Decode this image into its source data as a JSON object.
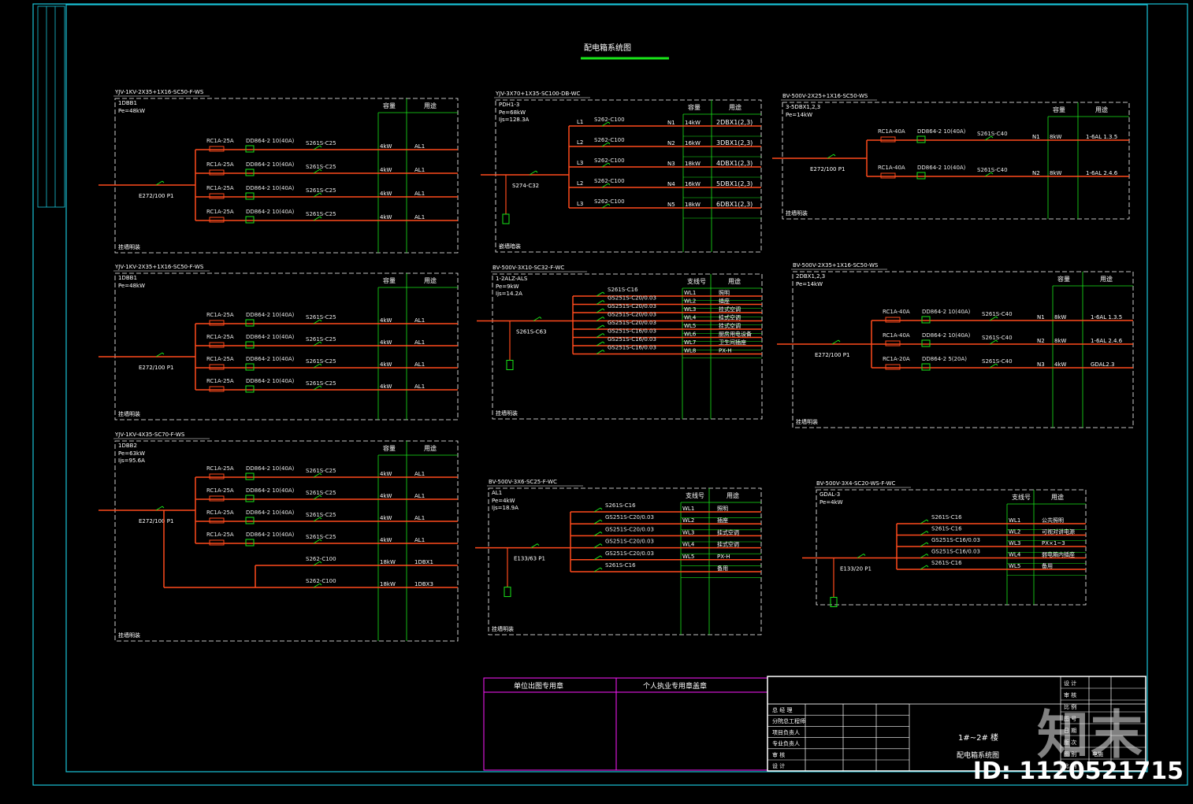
{
  "drawing_title": "配电箱系统图",
  "colors": {
    "frame": "#19c3d8",
    "box": "#ffffff",
    "bus": "#ff4a1c",
    "green": "#19e619",
    "tint": "#ff1aff"
  },
  "panels": [
    {
      "feeder": "YJV-1KV-2X35+1X16-SC50-F-WS",
      "box_id": "1DBB1",
      "info": [
        "Pe=48kW"
      ],
      "main_switch": "E272/100 P1",
      "note": "挂墙明装",
      "headers": [
        "容量",
        "用途"
      ],
      "circuits": [
        {
          "rcd": "RC1A-25A",
          "meter": "DD864-2 10(40A)",
          "brk": "S261S-C25",
          "cap": "4kW",
          "use": "AL1"
        },
        {
          "rcd": "RC1A-25A",
          "meter": "DD864-2 10(40A)",
          "brk": "S261S-C25",
          "cap": "4kW",
          "use": "AL1"
        },
        {
          "rcd": "RC1A-25A",
          "meter": "DD864-2 10(40A)",
          "brk": "S261S-C25",
          "cap": "4kW",
          "use": "AL1"
        },
        {
          "rcd": "RC1A-25A",
          "meter": "DD864-2 10(40A)",
          "brk": "S261S-C25",
          "cap": "4kW",
          "use": "AL1"
        }
      ]
    },
    {
      "feeder": "YJV-1KV-2X35+1X16-SC50-F-WS",
      "box_id": "1DBB1",
      "info": [
        "Pe=48kW"
      ],
      "main_switch": "E272/100 P1",
      "note": "挂墙明装",
      "headers": [
        "容量",
        "用途"
      ],
      "circuits": [
        {
          "rcd": "RC1A-25A",
          "meter": "DD864-2 10(40A)",
          "brk": "S261S-C25",
          "cap": "4kW",
          "use": "AL1"
        },
        {
          "rcd": "RC1A-25A",
          "meter": "DD864-2 10(40A)",
          "brk": "S261S-C25",
          "cap": "4kW",
          "use": "AL1"
        },
        {
          "rcd": "RC1A-25A",
          "meter": "DD864-2 10(40A)",
          "brk": "S261S-C25",
          "cap": "4kW",
          "use": "AL1"
        },
        {
          "rcd": "RC1A-25A",
          "meter": "DD864-2 10(40A)",
          "brk": "S261S-C25",
          "cap": "4kW",
          "use": "AL1"
        }
      ]
    },
    {
      "feeder": "YJV-1KV-4X35-SC70-F-WS",
      "box_id": "1DBB2",
      "info": [
        "Pe=63kW",
        "Ijs=95.6A"
      ],
      "main_switch": "E272/100 P1",
      "note": "挂墙明装",
      "headers": [
        "容量",
        "用途"
      ],
      "circuits": [
        {
          "rcd": "RC1A-25A",
          "meter": "DD864-2 10(40A)",
          "brk": "S261S-C25",
          "cap": "4kW",
          "use": "AL1"
        },
        {
          "rcd": "RC1A-25A",
          "meter": "DD864-2 10(40A)",
          "brk": "S261S-C25",
          "cap": "4kW",
          "use": "AL1"
        },
        {
          "rcd": "RC1A-25A",
          "meter": "DD864-2 10(40A)",
          "brk": "S261S-C25",
          "cap": "4kW",
          "use": "AL1"
        },
        {
          "rcd": "RC1A-25A",
          "meter": "DD864-2 10(40A)",
          "brk": "S261S-C25",
          "cap": "4kW",
          "use": "AL1"
        },
        {
          "rcd": "",
          "meter": "",
          "brk": "S262-C100",
          "cap": "18kW",
          "use": "1DBX1"
        },
        {
          "rcd": "",
          "meter": "",
          "brk": "S262-C100",
          "cap": "18kW",
          "use": "1DBX3"
        }
      ]
    },
    {
      "feeder": "YJV-3X70+1X35-SC100-DB-WC",
      "box_id": "PDH1-3",
      "info": [
        "Pe=68kW",
        "Ijs=128.3A"
      ],
      "main_switch": "S274-C32",
      "note": "嵌墙暗装",
      "headers": [
        "容量",
        "用途"
      ],
      "circuits": [
        {
          "phase": "L1",
          "brk": "S262-C100",
          "cap": "14kW",
          "use": "2DBX1(2,3)"
        },
        {
          "phase": "L2",
          "brk": "S262-C100",
          "cap": "16kW",
          "use": "3DBX1(2,3)"
        },
        {
          "phase": "L3",
          "brk": "S262-C100",
          "cap": "18kW",
          "use": "4DBX1(2,3)"
        },
        {
          "phase": "L2",
          "brk": "S262-C100",
          "cap": "16kW",
          "use": "5DBX1(2,3)"
        },
        {
          "phase": "L3",
          "brk": "S262-C100",
          "cap": "18kW",
          "use": "6DBX1(2,3)"
        }
      ]
    },
    {
      "feeder": "BV-500V-3X10-SC32-F-WC",
      "box_id": "1-2ALZ-ALS",
      "info": [
        "Pe=9kW",
        "Ijs=14.2A"
      ],
      "main_switch": "S261S-C63",
      "note": "挂墙明装",
      "headers": [
        "支线号",
        "用途"
      ],
      "circuits": [
        {
          "brk": "S261S-C16",
          "cap": "WL1",
          "use": "照明"
        },
        {
          "brk": "GS251S-C20/0.03",
          "cap": "WL2",
          "use": "插座"
        },
        {
          "brk": "GS251S-C20/0.03",
          "cap": "WL3",
          "use": "挂式空调"
        },
        {
          "brk": "GS251S-C20/0.03",
          "cap": "WL4",
          "use": "挂式空调"
        },
        {
          "brk": "GS251S-C20/0.03",
          "cap": "WL5",
          "use": "挂式空调"
        },
        {
          "brk": "GS251S-C16/0.03",
          "cap": "WL6",
          "use": "厨房用电设备"
        },
        {
          "brk": "GS251S-C16/0.03",
          "cap": "WL7",
          "use": "卫生间插座"
        },
        {
          "brk": "GS251S-C16/0.03",
          "cap": "WL8",
          "use": "PX-H"
        }
      ]
    },
    {
      "feeder": "BV-500V-3X6-SC25-F-WC",
      "box_id": "AL1",
      "info": [
        "Pe=4kW",
        "Ijs=18.9A"
      ],
      "main_switch": "E133/63 P1",
      "note": "挂墙明装",
      "headers": [
        "支线号",
        "用途"
      ],
      "circuits": [
        {
          "brk": "S261S-C16",
          "cap": "WL1",
          "use": "照明"
        },
        {
          "brk": "GS251S-C20/0.03",
          "cap": "WL2",
          "use": "插座"
        },
        {
          "brk": "GS251S-C20/0.03",
          "cap": "WL3",
          "use": "挂式空调"
        },
        {
          "brk": "GS251S-C20/0.03",
          "cap": "WL4",
          "use": "挂式空调"
        },
        {
          "brk": "GS251S-C20/0.03",
          "cap": "WL5",
          "use": "PX-H"
        },
        {
          "brk": "S261S-C16",
          "cap": "",
          "use": "备用"
        }
      ]
    },
    {
      "feeder": "BV-500V-2X25+1X16-SC50-WS",
      "box_id": "3-5DBX1,2,3",
      "info": [
        "Pe=14kW"
      ],
      "main_switch": "E272/100 P1",
      "note": "挂墙明装",
      "headers": [
        "容量",
        "用途"
      ],
      "circuits": [
        {
          "rcd": "RC1A-40A",
          "meter": "DD864-2 10(40A)",
          "brk": "S261S-C40",
          "cap": "8kW",
          "use": "1-6AL 1.3.5"
        },
        {
          "rcd": "RC1A-40A",
          "meter": "DD864-2 10(40A)",
          "brk": "S261S-C40",
          "cap": "8kW",
          "use": "1-6AL 2.4.6"
        }
      ]
    },
    {
      "feeder": "BV-500V-2X35+1X16-SC50-WS",
      "box_id": "2DBX1,2,3",
      "info": [
        "Pe=14kW"
      ],
      "main_switch": "E272/100 P1",
      "note": "挂墙明装",
      "headers": [
        "容量",
        "用途"
      ],
      "circuits": [
        {
          "rcd": "RC1A-40A",
          "meter": "DD864-2 10(40A)",
          "brk": "S261S-C40",
          "cap": "8kW",
          "use": "1-6AL 1.3.5"
        },
        {
          "rcd": "RC1A-40A",
          "meter": "DD864-2 10(40A)",
          "brk": "S261S-C40",
          "cap": "8kW",
          "use": "1-6AL 2.4.6"
        },
        {
          "rcd": "RC1A-20A",
          "meter": "DD864-2 5(20A)",
          "brk": "S261S-C40",
          "cap": "4kW",
          "use": "GDAL2.3"
        }
      ]
    },
    {
      "feeder": "BV-500V-3X4-SC20-WS-F-WC",
      "box_id": "GDAL-3",
      "info": [
        "Pe=4kW"
      ],
      "main_switch": "E133/20 P1",
      "note": "",
      "headers": [
        "支线号",
        "用途"
      ],
      "circuits": [
        {
          "brk": "S261S-C16",
          "cap": "WL1",
          "use": "公共照明"
        },
        {
          "brk": "S261S-C16",
          "cap": "WL2",
          "use": "可视对讲电源"
        },
        {
          "brk": "GS251S-C16/0.03",
          "cap": "WL3",
          "use": "PX×1~3"
        },
        {
          "brk": "GS251S-C16/0.03",
          "cap": "WL4",
          "use": "弱电箱内插座"
        },
        {
          "brk": "S261S-C16",
          "cap": "WL5",
          "use": "备用"
        }
      ]
    }
  ],
  "stamp_boxes": {
    "unit_seal": "单位出图专用章",
    "personal_seal": "个人执业专用章盖章"
  },
  "title_block": {
    "rows": [
      "总 经 理",
      "分院总工程师",
      "项目负责人",
      "专业负责人",
      "审 核",
      "设 计"
    ],
    "project": "1#~2# 楼",
    "drawing": "配电箱系统图",
    "right_rows": [
      "设 计",
      "审 核",
      "比 例",
      "图 号",
      "日 期",
      "版 次",
      "图 别",
      "比 例"
    ],
    "right_values": [
      "",
      "",
      "",
      "",
      "",
      "",
      "电施",
      ""
    ]
  },
  "watermark": {
    "logo": "知末",
    "id": "ID: 1120521715"
  }
}
